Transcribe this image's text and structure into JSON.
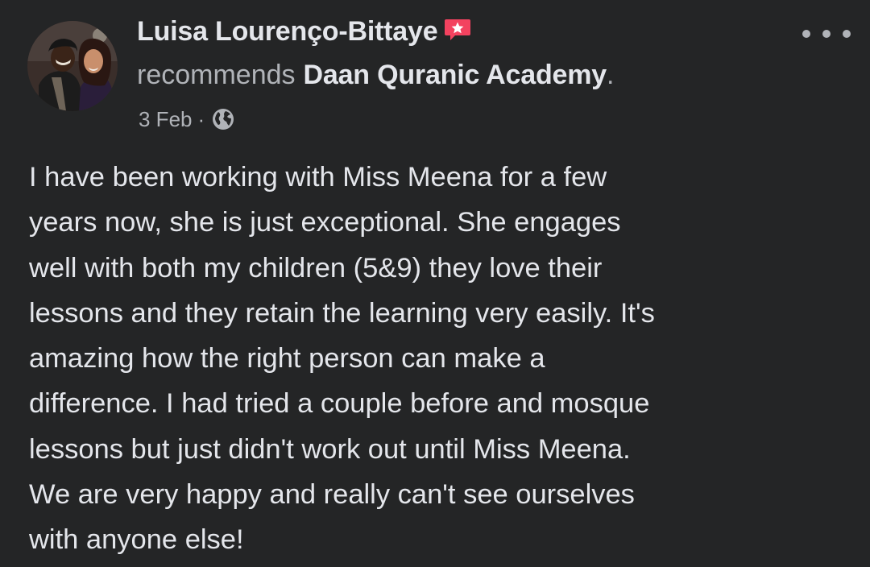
{
  "post": {
    "author": {
      "name": "Luisa Lourenço-Bittaye",
      "badge_icon": "recommendation-star-icon",
      "avatar": "profile-photo"
    },
    "recommendation": {
      "verb": "recommends",
      "page": "Daan Quranic Academy",
      "end": "."
    },
    "meta": {
      "date": "3 Feb",
      "separator": "·",
      "audience_icon": "globe-icon"
    },
    "more_icon": "more-options-icon",
    "body_lines": [
      "I have been working with Miss Meena for a few",
      "years now, she is just exceptional. She engages",
      "well with both my children (5&9) they love their",
      "lessons and they retain the learning very easily. It's",
      "amazing how the right person can make a",
      "difference. I had tried a couple before and mosque",
      "lessons but just didn't work out until Miss Meena.",
      "We are very happy and really can't see ourselves",
      "with anyone else!"
    ]
  },
  "colors": {
    "background": "#242526",
    "primary_text": "#e4e6eb",
    "secondary_text": "#b0b3b8",
    "badge": "#f3425f"
  }
}
